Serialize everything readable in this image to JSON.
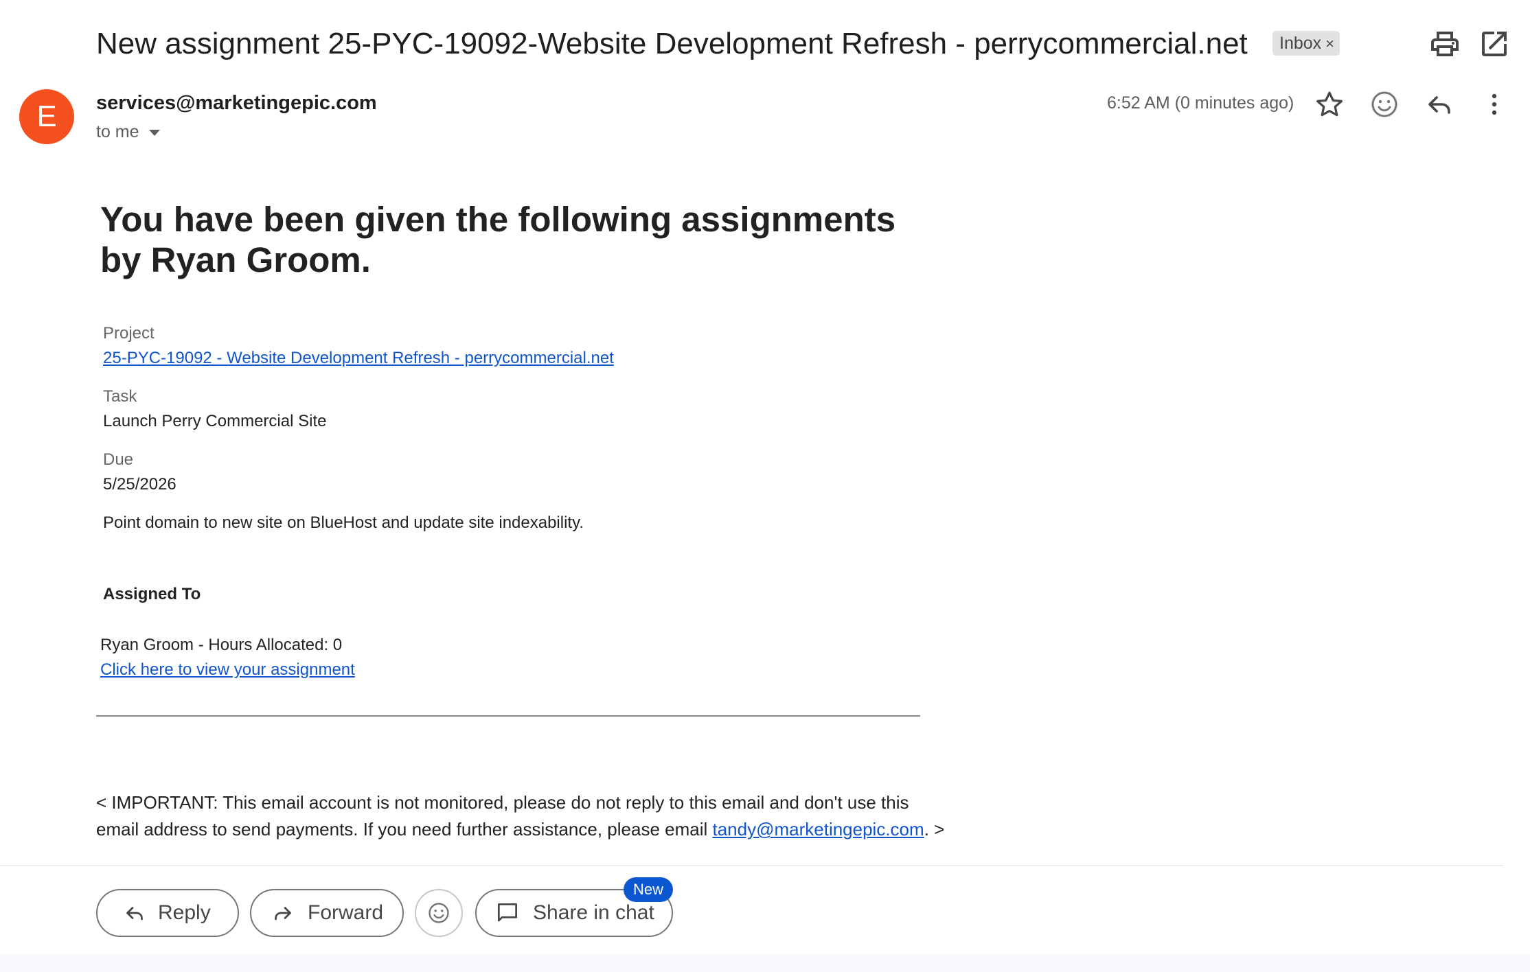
{
  "email": {
    "subject": "New assignment 25-PYC-19092-Website Development Refresh - perrycommercial.net",
    "label": "Inbox",
    "label_remove": "×",
    "sender": "services@marketingepic.com",
    "avatar_letter": "E",
    "recipient": "to me",
    "timestamp": "6:52 AM (0 minutes ago)"
  },
  "icons": {
    "top": [
      "print-icon",
      "open-in-new-window-icon"
    ],
    "header": [
      "star-icon",
      "add-reaction-icon",
      "reply-icon",
      "more-vert-icon"
    ]
  },
  "body": {
    "headline": "You have been given the following assignments by Ryan Groom.",
    "project_label": "Project",
    "project_link": "25-PYC-19092 - Website Development Refresh - perrycommercial.net",
    "task_label": "Task",
    "task_value": "Launch Perry Commercial Site",
    "due_label": "Due",
    "due_value": "5/25/2026",
    "description": "Point domain to new site on BlueHost and update site indexability.",
    "assigned_to_label": "Assigned To",
    "assignee": "Ryan Groom - Hours Allocated: 0",
    "view_link": "Click here to view your assignment",
    "notice_text": "< IMPORTANT: This email account is not monitored, please do not reply to this email and don't use this email address to send payments. If you need further assistance, please email ",
    "notice_email": "tandy@marketingepic.com",
    "notice_end": ". >"
  },
  "actions": {
    "reply": "Reply",
    "forward": "Forward",
    "share_in_chat": "Share in chat",
    "new_badge": "New"
  },
  "colors": {
    "avatar": "#f4511e",
    "link": "#1155cc",
    "badge": "#0b57d0"
  }
}
